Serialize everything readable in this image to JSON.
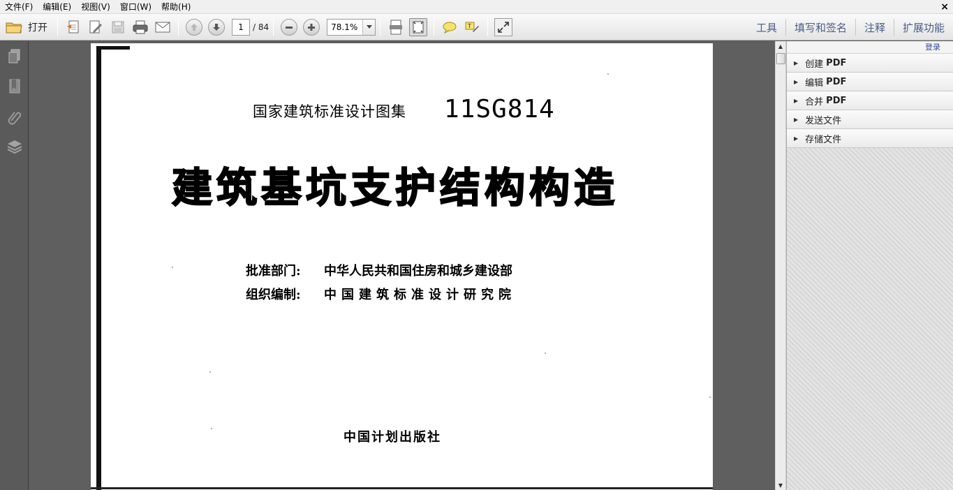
{
  "menubar": {
    "items": [
      "文件(F)",
      "编辑(E)",
      "视图(V)",
      "窗口(W)",
      "帮助(H)"
    ],
    "close": "×"
  },
  "toolbar": {
    "open_label": "打开",
    "page_current": "1",
    "page_total": "/ 84",
    "zoom": "78.1%",
    "right_links": [
      "工具",
      "填写和签名",
      "注释",
      "扩展功能"
    ]
  },
  "document": {
    "series": "国家建筑标准设计图集",
    "code": "11SG814",
    "title": "建筑基坑支护结构构造",
    "approval_label": "批准部门:",
    "approval_value": "中华人民共和国住房和城乡建设部",
    "compiler_label": "组织编制:",
    "compiler_value": "中国建筑标准设计研究院",
    "publisher": "中国计划出版社"
  },
  "rightpanel": {
    "login": "登录",
    "items": [
      {
        "label": "创建",
        "suffix": "PDF"
      },
      {
        "label": "编辑",
        "suffix": "PDF"
      },
      {
        "label": "合并",
        "suffix": "PDF"
      },
      {
        "label": "发送文件",
        "suffix": ""
      },
      {
        "label": "存储文件",
        "suffix": ""
      }
    ]
  },
  "colors": {
    "toolbar_link": "#4a5e8a",
    "login_link": "#2a4b9b",
    "doc_bg": "#5f5f5f"
  }
}
